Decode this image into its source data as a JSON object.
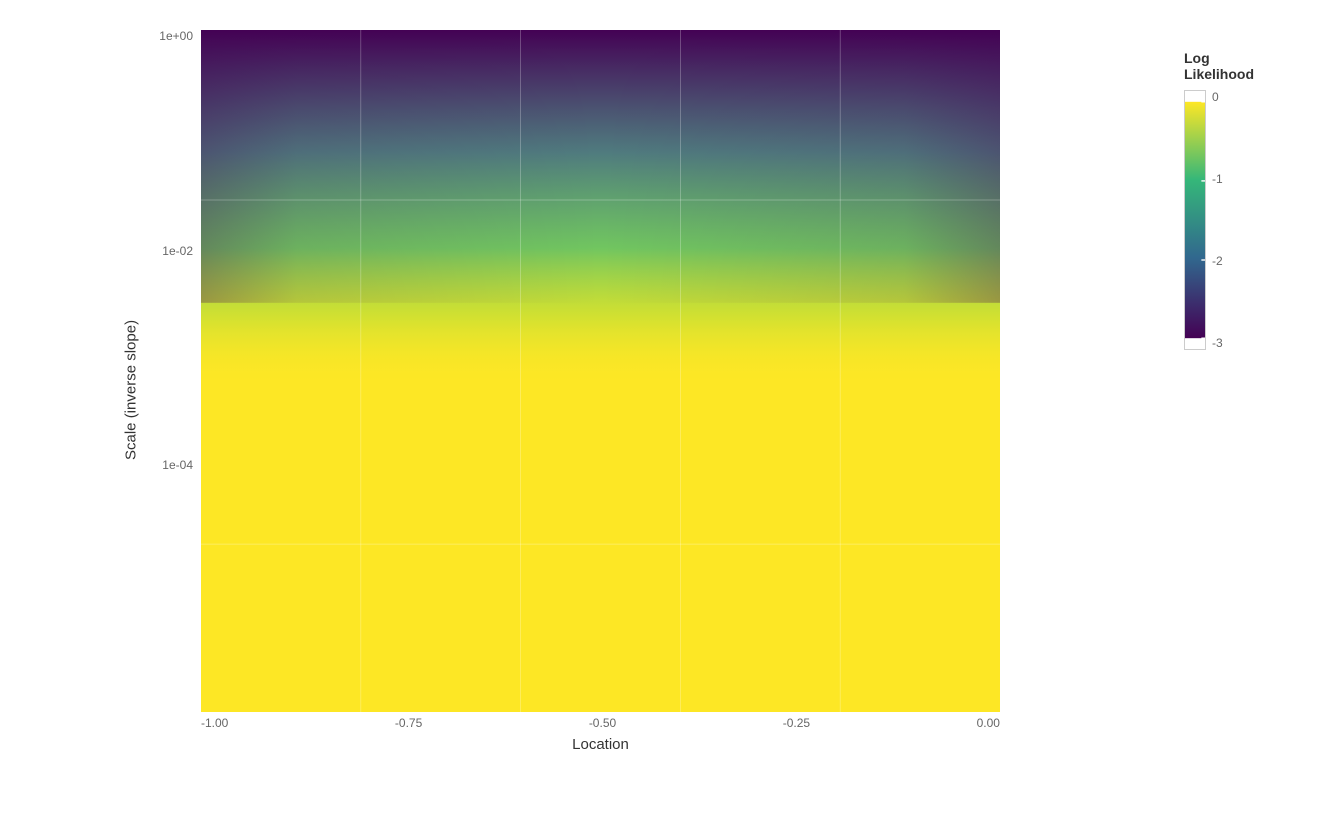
{
  "chart": {
    "title": "",
    "x_axis": {
      "label": "Location",
      "ticks": [
        "-1.00",
        "-0.75",
        "-0.50",
        "-0.25",
        "0.00"
      ]
    },
    "y_axis": {
      "label": "Scale (inverse slope)",
      "ticks": [
        "1e+00",
        "1e-02",
        "1e-04"
      ]
    },
    "legend": {
      "title_line1": "Log",
      "title_line2": "Likelihood",
      "ticks": [
        "0",
        "-1",
        "-2",
        "-3"
      ],
      "colors": {
        "top": "#440154",
        "upper_mid": "#31688e",
        "mid": "#35b779",
        "lower_mid": "#90d743",
        "bottom": "#fde725"
      }
    }
  }
}
